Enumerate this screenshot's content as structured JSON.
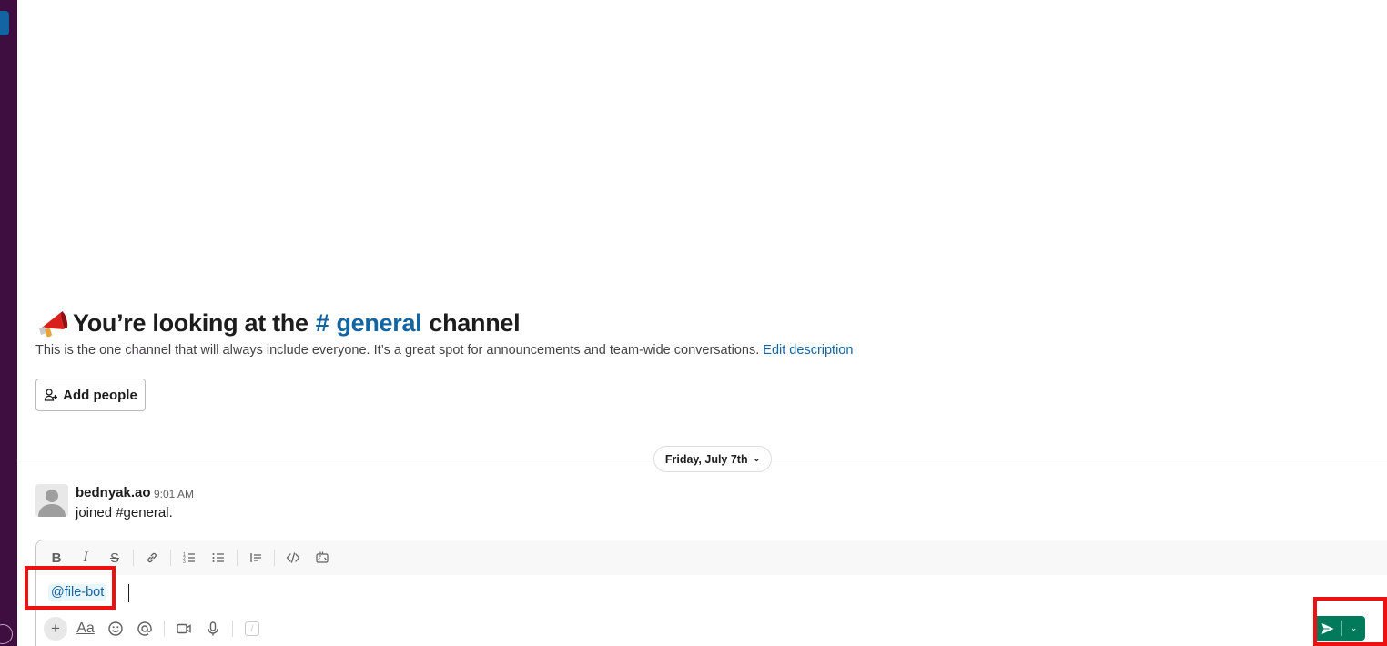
{
  "channel_intro": {
    "title_prefix": "You’re looking at the",
    "hash": "#",
    "channel_name": "general",
    "title_suffix": "channel",
    "description": "This is the one channel that will always include everyone. It’s a great spot for announcements and team-wide conversations.",
    "edit_description_link": "Edit description",
    "add_people_label": "Add people"
  },
  "day_divider": {
    "label": "Friday, July 7th"
  },
  "messages": [
    {
      "author": "bednyak.ao",
      "time": "9:01 AM",
      "text": "joined #general."
    }
  ],
  "composer": {
    "mention": "@file-bot",
    "toolbar": {
      "bold": "B",
      "italic": "I",
      "strikethrough": "S",
      "format_text": "Aa",
      "plus": "+",
      "slash": "/"
    }
  },
  "colors": {
    "sidebar": "#3f0e40",
    "link": "#1264a3",
    "send_button": "#007a5a",
    "annotation": "#ee1111"
  }
}
